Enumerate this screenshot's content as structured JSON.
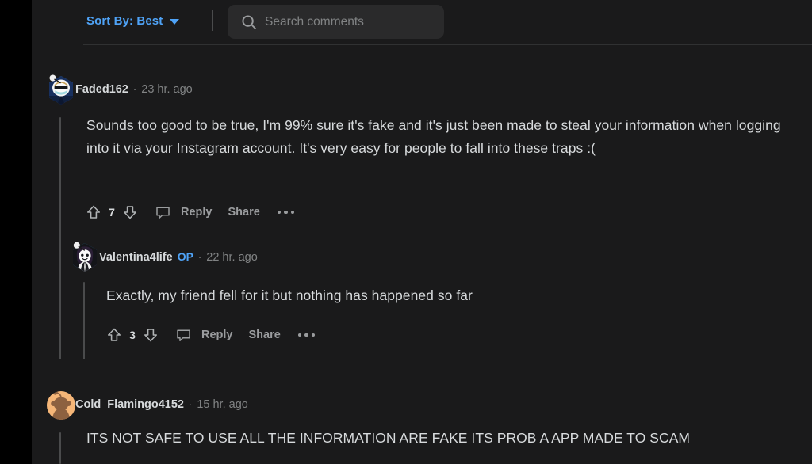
{
  "toolbar": {
    "sort_label": "Sort By: Best",
    "sort_caret_icon": "chevron-down-icon",
    "search_icon": "search-icon",
    "search_placeholder": "Search comments",
    "search_value": ""
  },
  "colors": {
    "page_background": "#000000",
    "content_background": "#1a1a1b",
    "body_text": "#d7dadc",
    "muted_text": "#818384",
    "action_text": "#9a9c9e",
    "accent_blue": "#4fa3f7",
    "threadline": "#4a4b4c",
    "search_field": "#2a2a2b",
    "divider": "#303132"
  },
  "comments": [
    {
      "id": "comment-1",
      "author": "Faded162",
      "is_op": false,
      "op_label": "",
      "separator": "·",
      "timestamp": "23 hr. ago",
      "body": "Sounds too good to be true, I'm 99% sure it's fake and it's just been made to steal your information when logging into it via your Instagram account. It's very easy for people to fall into these traps :(",
      "score": "7",
      "upvote_icon": "upvote-arrow-icon",
      "downvote_icon": "downvote-arrow-icon",
      "reply_icon": "comment-bubble-icon",
      "reply_label": "Reply",
      "share_label": "Share",
      "overflow_icon": "more-options-icon",
      "avatar": {
        "type": "hexagon-nft-avatar",
        "border_gradient": [
          "#3fb6d9",
          "#4a7fe0",
          "#8a5cd6"
        ],
        "background": "#1b2a5e",
        "hood": "#f2f2f2",
        "accessory": "sunglasses-and-face-mask"
      }
    },
    {
      "id": "comment-2",
      "author": "Valentina4life",
      "is_op": true,
      "op_label": "OP",
      "separator": "·",
      "timestamp": "22 hr. ago",
      "body": "Exactly, my friend fell for it but nothing has happened so far",
      "score": "3",
      "upvote_icon": "upvote-arrow-icon",
      "downvote_icon": "downvote-arrow-icon",
      "reply_icon": "comment-bubble-icon",
      "reply_label": "Reply",
      "share_label": "Share",
      "overflow_icon": "more-options-icon",
      "avatar": {
        "type": "hexagon-nft-avatar",
        "border_gradient": [
          "#2fd0e8",
          "#3f8fe0",
          "#7a55c8"
        ],
        "background": "#14151a",
        "hair": "#2a1f33",
        "accessory": "long-dark-hair"
      }
    },
    {
      "id": "comment-3",
      "author": "Cold_Flamingo4152",
      "is_op": false,
      "op_label": "",
      "separator": "·",
      "timestamp": "15 hr. ago",
      "body": "ITS NOT SAFE TO USE ALL THE INFORMATION ARE FAKE ITS PROB A APP MADE TO SCAM",
      "score": "",
      "upvote_icon": "",
      "downvote_icon": "",
      "reply_icon": "",
      "reply_label": "",
      "share_label": "",
      "overflow_icon": "",
      "avatar": {
        "type": "circle-snoo-avatar",
        "background": "#f5b678",
        "figure": "#8d6140"
      }
    }
  ]
}
